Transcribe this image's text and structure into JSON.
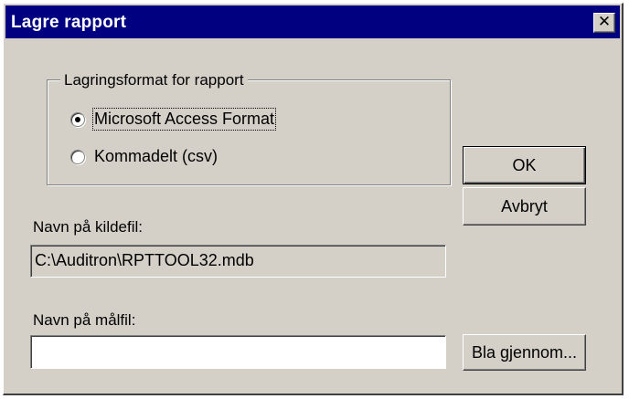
{
  "window": {
    "title": "Lagre rapport",
    "close_glyph": "✕"
  },
  "format_group": {
    "legend": "Lagringsformat for rapport",
    "options": [
      {
        "label": "Microsoft Access Format",
        "selected": true
      },
      {
        "label": "Kommadelt (csv)",
        "selected": false
      }
    ]
  },
  "buttons": {
    "ok": "OK",
    "cancel": "Avbryt",
    "browse": "Bla gjennom..."
  },
  "source_file": {
    "label": "Navn på kildefil:",
    "value": "C:\\Auditron\\RPTTOOL32.mdb"
  },
  "target_file": {
    "label": "Navn på målfil:",
    "value": ""
  },
  "icons": {
    "close": "close-icon",
    "radio": "radio-button-icon"
  }
}
